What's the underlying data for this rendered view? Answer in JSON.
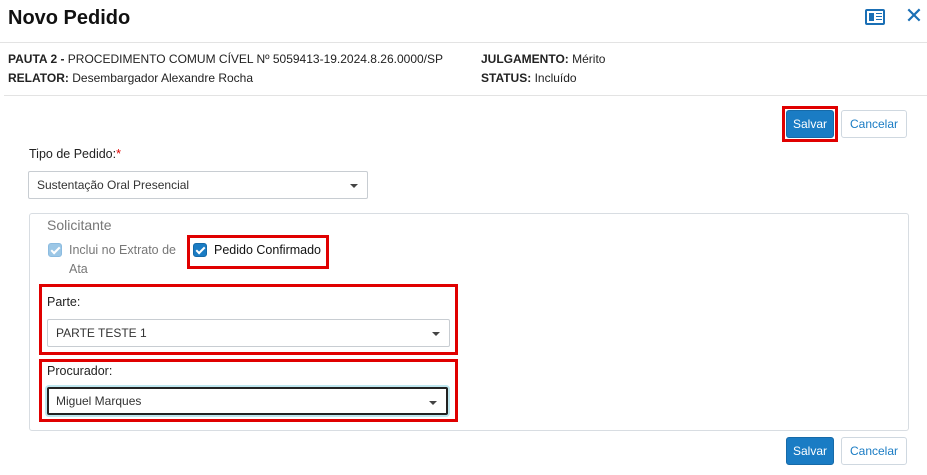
{
  "dialog": {
    "title": "Novo Pedido",
    "close_icon": "close-icon",
    "panel_icon": "panel-toggle-icon"
  },
  "info": {
    "pauta_label": "PAUTA 2 -",
    "pauta_value": "PROCEDIMENTO COMUM CÍVEL Nº 5059413-19.2024.8.26.0000/SP",
    "relator_label": "RELATOR:",
    "relator_value": "Desembargador Alexandre Rocha",
    "julgamento_label": "JULGAMENTO:",
    "julgamento_value": "Mérito",
    "status_label": "STATUS:",
    "status_value": "Incluído"
  },
  "actions": {
    "save_label": "Salvar",
    "cancel_label": "Cancelar"
  },
  "form": {
    "tipo_label": "Tipo de Pedido:",
    "tipo_required": "*",
    "tipo_value": "Sustentação Oral Presencial",
    "solicitante_title": "Solicitante",
    "inclui_extrato_label_line1": "Inclui no Extrato de",
    "inclui_extrato_label_line2": "Ata",
    "inclui_extrato_checked": true,
    "pedido_confirmado_label": "Pedido Confirmado",
    "pedido_confirmado_checked": true,
    "parte_label": "Parte:",
    "parte_value": "PARTE TESTE 1",
    "procurador_label": "Procurador:",
    "procurador_value": "Miguel Marques"
  },
  "colors": {
    "primary": "#1a7cc4",
    "highlight": "#e00000",
    "required": "#e00000"
  }
}
